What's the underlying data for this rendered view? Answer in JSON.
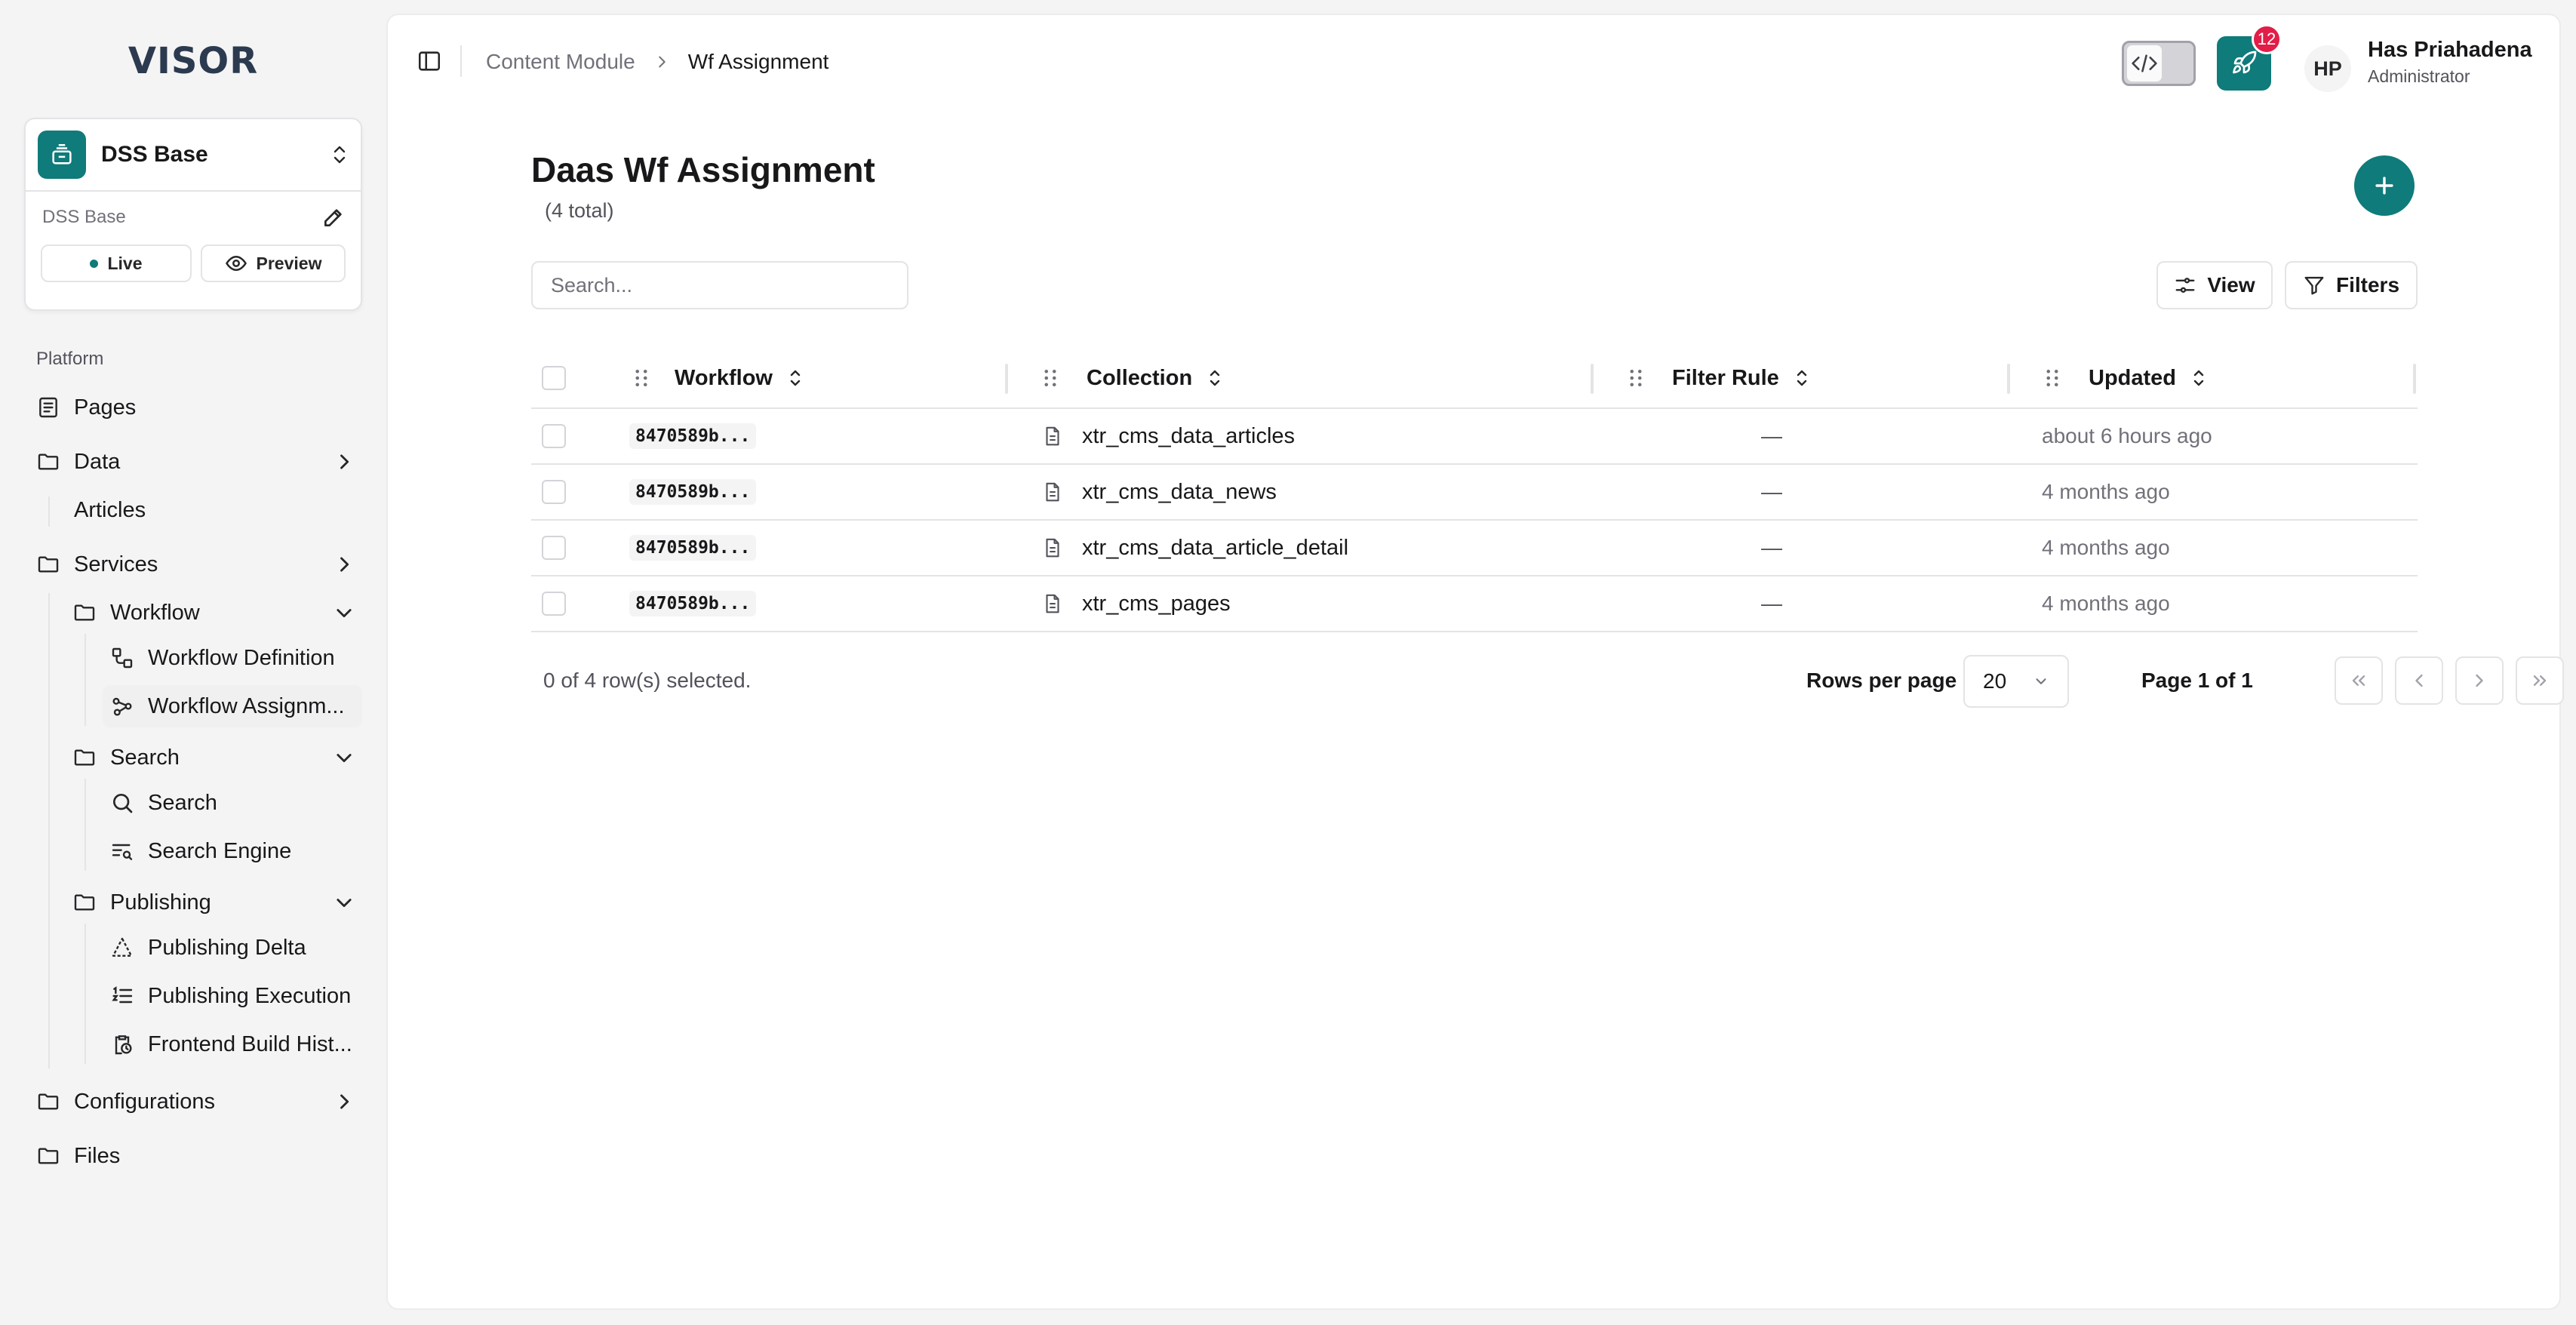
{
  "brand": {
    "logo_text": "VISOR"
  },
  "site": {
    "name": "DSS Base",
    "sub_label": "DSS Base",
    "live_label": "Live",
    "preview_label": "Preview"
  },
  "sidebar": {
    "section_label": "Platform",
    "items": {
      "pages": "Pages",
      "data": "Data",
      "articles": "Articles",
      "services": "Services",
      "workflow": "Workflow",
      "workflow_definition": "Workflow Definition",
      "workflow_assignment": "Workflow Assignm...",
      "search_group": "Search",
      "search": "Search",
      "search_engine": "Search Engine",
      "publishing": "Publishing",
      "publishing_delta": "Publishing Delta",
      "publishing_execution": "Publishing Execution",
      "frontend_build": "Frontend Build Hist...",
      "configurations": "Configurations",
      "files": "Files"
    }
  },
  "header": {
    "breadcrumb_parent": "Content Module",
    "breadcrumb_current": "Wf Assignment",
    "notifications_count": "12",
    "user_initials": "HP",
    "user_name": "Has Priahadena",
    "user_role": "Administrator"
  },
  "page": {
    "title": "Daas Wf Assignment",
    "count": "(4 total)",
    "search_placeholder": "Search...",
    "view_label": "View",
    "filters_label": "Filters"
  },
  "table": {
    "columns": [
      "Workflow",
      "Collection",
      "Filter Rule",
      "Updated"
    ],
    "rows": [
      {
        "workflow": "8470589b...",
        "collection": "xtr_cms_data_articles",
        "filter_rule": "—",
        "updated": "about 6 hours ago"
      },
      {
        "workflow": "8470589b...",
        "collection": "xtr_cms_data_news",
        "filter_rule": "—",
        "updated": "4 months ago"
      },
      {
        "workflow": "8470589b...",
        "collection": "xtr_cms_data_article_detail",
        "filter_rule": "—",
        "updated": "4 months ago"
      },
      {
        "workflow": "8470589b...",
        "collection": "xtr_cms_pages",
        "filter_rule": "—",
        "updated": "4 months ago"
      }
    ]
  },
  "footer": {
    "selected_text": "0 of 4 row(s) selected.",
    "rows_per_page_label": "Rows per page",
    "rows_per_page_value": "20",
    "page_info": "Page 1 of 1"
  },
  "colors": {
    "accent": "#0f7b7a",
    "badge": "#e11d48",
    "border": "#e4e4e7",
    "muted_text": "#71717a"
  }
}
